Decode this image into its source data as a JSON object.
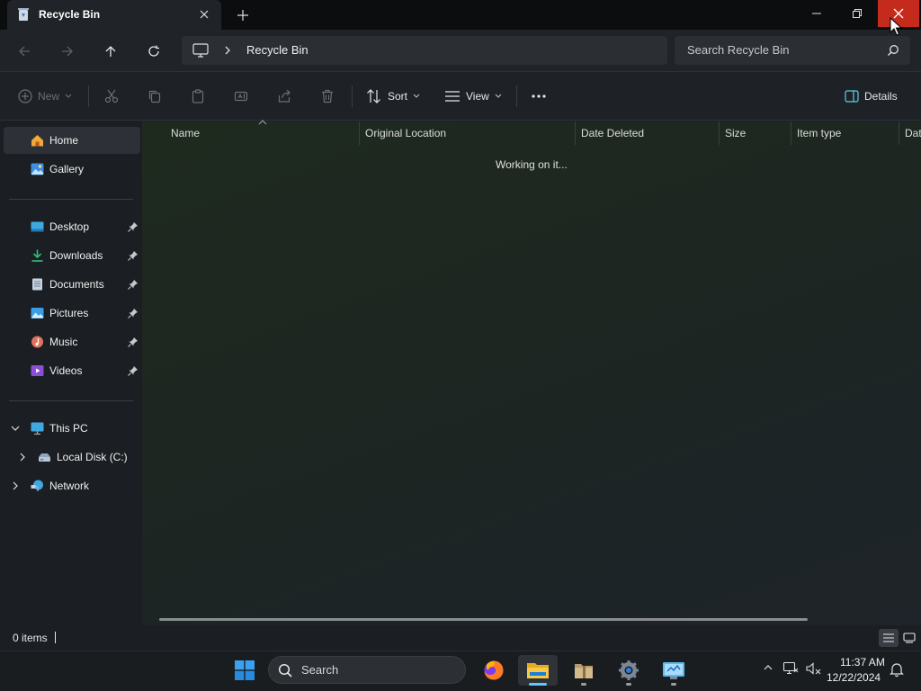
{
  "window": {
    "tab_title": "Recycle Bin"
  },
  "address": {
    "location": "Recycle Bin",
    "search_placeholder": "Search Recycle Bin"
  },
  "command_bar": {
    "new_label": "New",
    "sort_label": "Sort",
    "view_label": "View",
    "details_label": "Details"
  },
  "sidebar": {
    "quick": [
      {
        "label": "Home",
        "icon": "home-icon"
      },
      {
        "label": "Gallery",
        "icon": "gallery-icon"
      }
    ],
    "pinned": [
      {
        "label": "Desktop",
        "icon": "desktop-folder-icon"
      },
      {
        "label": "Downloads",
        "icon": "downloads-icon"
      },
      {
        "label": "Documents",
        "icon": "documents-icon"
      },
      {
        "label": "Pictures",
        "icon": "pictures-icon"
      },
      {
        "label": "Music",
        "icon": "music-icon"
      },
      {
        "label": "Videos",
        "icon": "videos-icon"
      }
    ],
    "tree": [
      {
        "label": "This PC",
        "icon": "this-pc-icon"
      },
      {
        "label": "Local Disk (C:)",
        "icon": "local-disk-icon"
      },
      {
        "label": "Network",
        "icon": "network-icon"
      }
    ]
  },
  "columns": [
    "Name",
    "Original Location",
    "Date Deleted",
    "Size",
    "Item type",
    "Dat"
  ],
  "content": {
    "status_message": "Working on it..."
  },
  "statusbar": {
    "item_count": "0 items"
  },
  "taskbar": {
    "search_label": "Search",
    "apps": [
      "firefox-icon",
      "file-explorer-icon",
      "archive-folder-icon",
      "settings-gear-icon",
      "control-panel-icon"
    ],
    "clock_time": "11:37 AM",
    "clock_date": "12/22/2024"
  },
  "colors": {
    "accent": "#0078d4",
    "close_red": "#c42b1c",
    "folder_yellow": "#f3c033"
  }
}
